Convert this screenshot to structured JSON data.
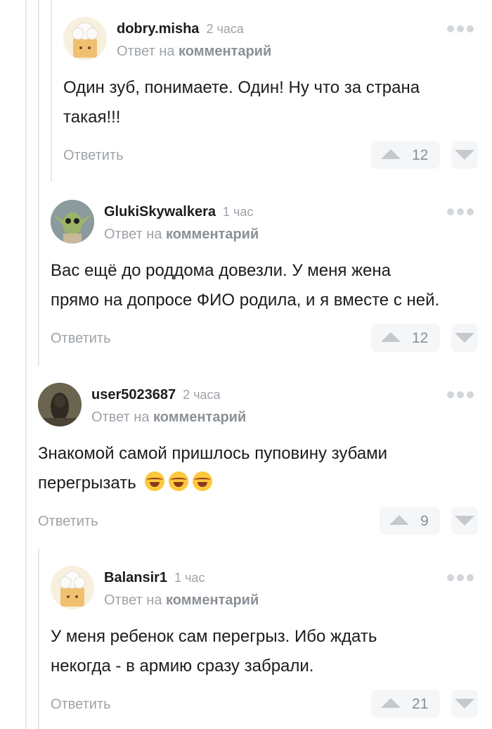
{
  "comments": [
    {
      "username": "dobry.misha",
      "time": "2 часа",
      "reply_prefix": "Ответ на",
      "reply_link": "комментарий",
      "lines": [
        "Один зуб, понимаете. Один! Ну что за страна",
        "такая!!!"
      ],
      "answer": "Ответить",
      "votes": "12",
      "avatar": "cook-hat-avatar-icon"
    },
    {
      "username": "GlukiSkywalkera",
      "time": "1 час",
      "reply_prefix": "Ответ на",
      "reply_link": "комментарий",
      "lines": [
        "Вас ещё до роддома довезли. У меня жена",
        "прямо на допросе ФИО родила, и я вместе с ней."
      ],
      "answer": "Ответить",
      "votes": "12",
      "avatar": "yoda-avatar-icon"
    },
    {
      "username": "user5023687",
      "time": "2 часа",
      "reply_prefix": "Ответ на",
      "reply_link": "комментарий",
      "lines": [
        "Знакомой самой пришлось пуповину зубами",
        "перегрызать"
      ],
      "emojis": [
        "tears-of-joy-emoji",
        "tears-of-joy-emoji",
        "tears-of-joy-emoji"
      ],
      "answer": "Ответить",
      "votes": "9",
      "avatar": "photo-avatar-icon"
    },
    {
      "username": "Balansir1",
      "time": "1 час",
      "reply_prefix": "Ответ на",
      "reply_link": "комментарий",
      "lines": [
        "У меня ребенок сам перегрыз. Ибо ждать",
        "некогда - в армию сразу забрали."
      ],
      "answer": "Ответить",
      "votes": "21",
      "avatar": "cook-hat-avatar-icon"
    }
  ]
}
